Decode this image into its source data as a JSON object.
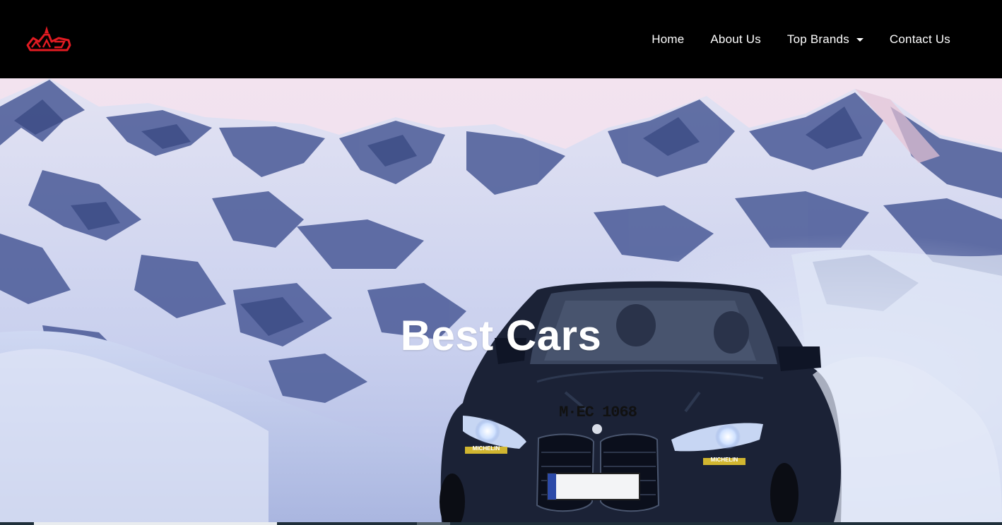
{
  "navbar": {
    "logo_icon": "maz-logo-icon",
    "brand_color": "#e21b22",
    "items": [
      {
        "label": "Home"
      },
      {
        "label": "About Us"
      },
      {
        "label": "Top Brands",
        "has_dropdown": true
      },
      {
        "label": "Contact Us"
      }
    ]
  },
  "hero": {
    "title": "Best Cars",
    "plate_text": "M·EC 1068",
    "decal_text": "MICHELIN"
  },
  "colors": {
    "navbar_bg": "#000000",
    "text": "#ffffff",
    "sky": "#efe2ee",
    "snow": "#cfd6f0",
    "rock": "#3f4f8c"
  }
}
